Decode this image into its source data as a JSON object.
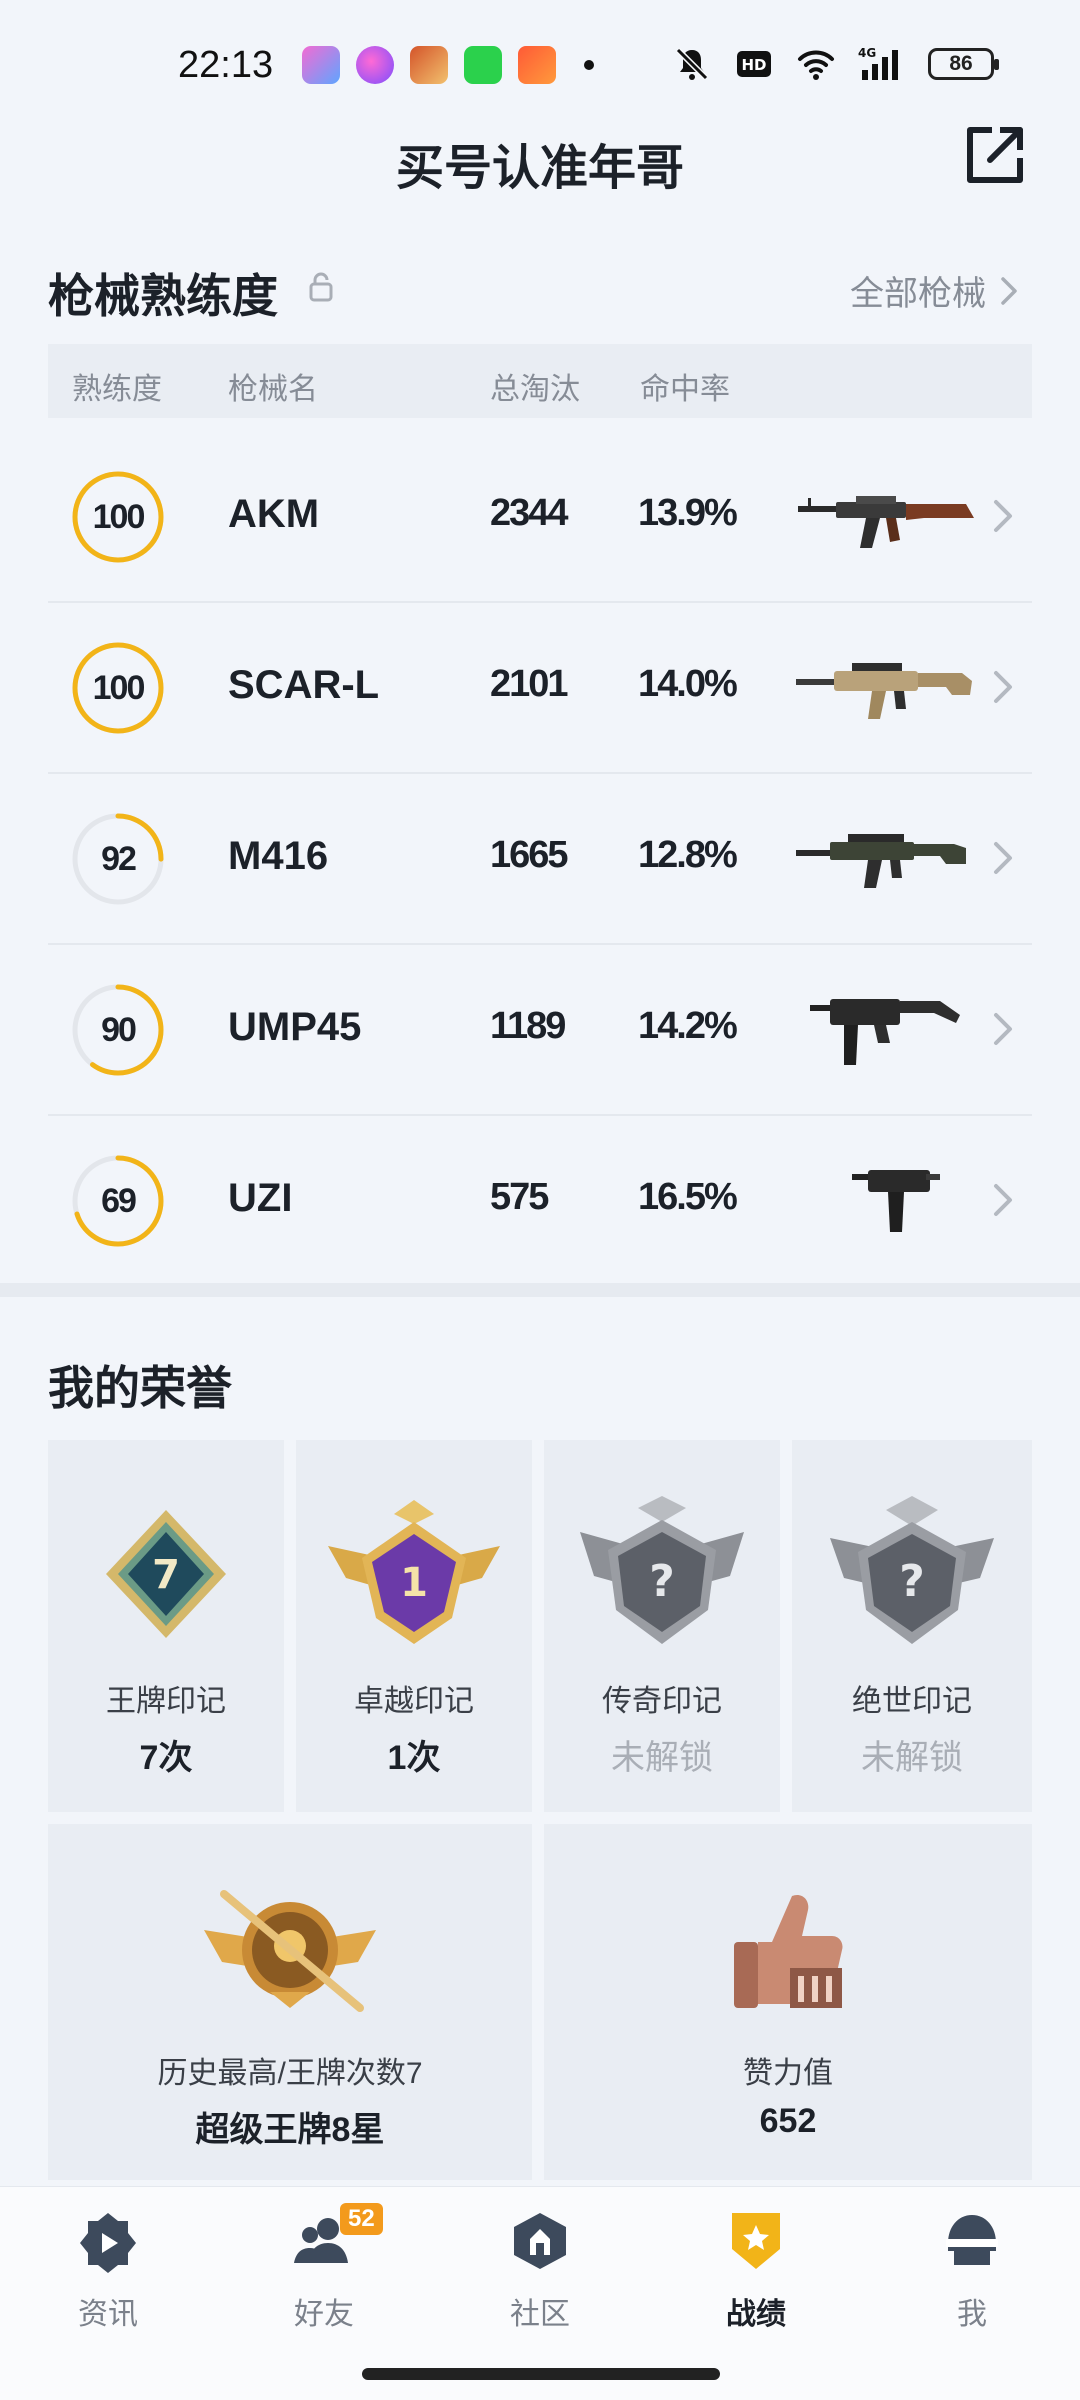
{
  "status_bar": {
    "time": "22:13",
    "battery": "86",
    "network": "4G"
  },
  "header": {
    "title": "买号认准年哥"
  },
  "weapons": {
    "heading": "枪械熟练度",
    "all_link": "全部枪械",
    "columns": [
      "熟练度",
      "枪械名",
      "总淘汰",
      "命中率"
    ],
    "rows": [
      {
        "level": "100",
        "name": "AKM",
        "kills": "2344",
        "rate": "13.9%",
        "progress": 1.0
      },
      {
        "level": "100",
        "name": "SCAR-L",
        "kills": "2101",
        "rate": "14.0%",
        "progress": 1.0
      },
      {
        "level": "92",
        "name": "M416",
        "kills": "1665",
        "rate": "12.8%",
        "progress": 0.25
      },
      {
        "level": "90",
        "name": "UMP45",
        "kills": "1189",
        "rate": "14.2%",
        "progress": 0.6
      },
      {
        "level": "69",
        "name": "UZI",
        "kills": "575",
        "rate": "16.5%",
        "progress": 0.7
      }
    ]
  },
  "honors": {
    "heading": "我的荣誉",
    "badges": [
      {
        "label": "王牌印记",
        "value": "7次",
        "locked": false,
        "mark": "7"
      },
      {
        "label": "卓越印记",
        "value": "1次",
        "locked": false,
        "mark": "1"
      },
      {
        "label": "传奇印记",
        "value": "未解锁",
        "locked": true,
        "mark": "?"
      },
      {
        "label": "绝世印记",
        "value": "未解锁",
        "locked": true,
        "mark": "?"
      }
    ],
    "highest": {
      "label": "历史最高/王牌次数7",
      "value": "超级王牌8星"
    },
    "praise": {
      "label": "赞力值",
      "value": "652"
    }
  },
  "nav": {
    "items": [
      {
        "label": "资讯",
        "icon": "news-icon"
      },
      {
        "label": "好友",
        "icon": "friends-icon",
        "badge": "52"
      },
      {
        "label": "社区",
        "icon": "community-icon"
      },
      {
        "label": "战绩",
        "icon": "record-icon",
        "active": true
      },
      {
        "label": "我",
        "icon": "profile-icon"
      }
    ]
  },
  "colors": {
    "accent": "#f2b418",
    "text": "#1c2129",
    "muted": "#868c96",
    "badge": "#f39a1c"
  }
}
